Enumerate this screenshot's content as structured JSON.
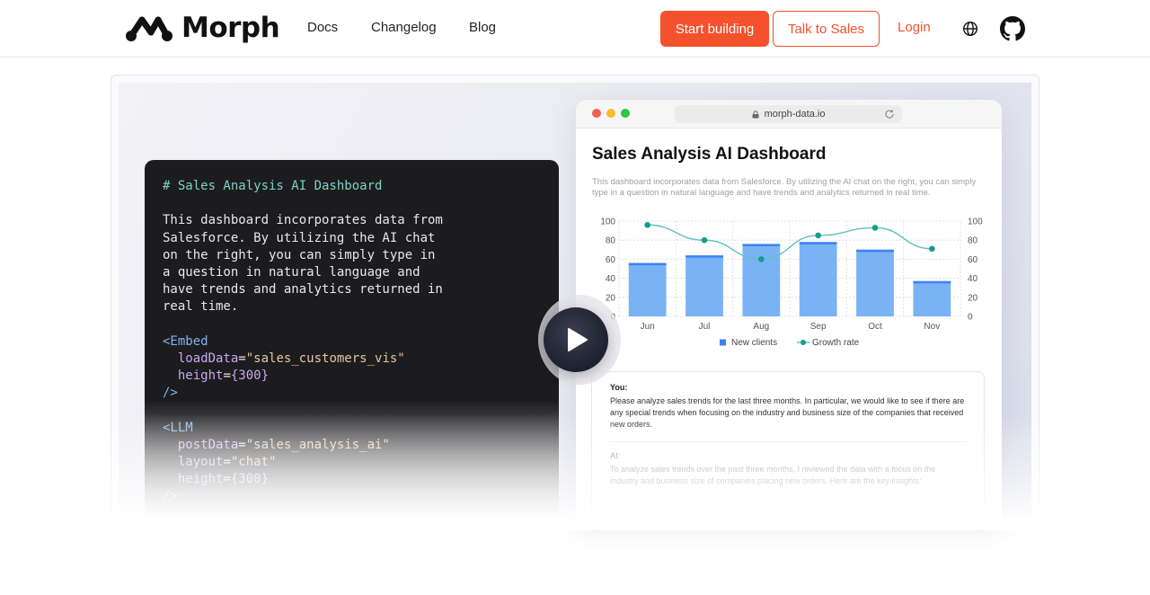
{
  "nav": {
    "logo_text": "Morph",
    "links": [
      "Docs",
      "Changelog",
      "Blog"
    ],
    "start_building": "Start building",
    "talk_to_sales": "Talk to Sales",
    "login": "Login"
  },
  "code_panel": {
    "lines": [
      {
        "text": "# Sales Analysis AI Dashboard",
        "kind": "comment"
      },
      {
        "text": "",
        "kind": "plain"
      },
      {
        "text": "This dashboard incorporates data from",
        "kind": "plain"
      },
      {
        "text": "Salesforce. By utilizing the AI chat",
        "kind": "plain"
      },
      {
        "text": "on the right, you can simply type in",
        "kind": "plain"
      },
      {
        "text": "a question in natural language and",
        "kind": "plain"
      },
      {
        "text": "have trends and analytics returned in",
        "kind": "plain"
      },
      {
        "text": "real time.",
        "kind": "plain"
      },
      {
        "text": "",
        "kind": "plain"
      },
      {
        "text": "<Embed",
        "kind": "tag"
      },
      {
        "text": "  loadData=\"sales_customers_vis\"",
        "kind": "attr"
      },
      {
        "text": "  height={300}",
        "kind": "attr"
      },
      {
        "text": "/>",
        "kind": "tag"
      },
      {
        "text": "",
        "kind": "plain"
      },
      {
        "text": "<LLM",
        "kind": "tag"
      },
      {
        "text": "  postData=\"sales_analysis_ai\"",
        "kind": "attr"
      },
      {
        "text": "  layout=\"chat\"",
        "kind": "attr"
      },
      {
        "text": "  height={300}",
        "kind": "attr"
      },
      {
        "text": "/>",
        "kind": "tag"
      }
    ]
  },
  "browser": {
    "url": "morph-data.io",
    "dashboard_title": "Sales Analysis AI Dashboard",
    "dashboard_desc": "This dashboard incorporates data from Salesforce. By utilizing the AI chat on the right, you can simply type in a question in natural language and have trends and analytics returned in real time."
  },
  "chart_data": {
    "type": "bar",
    "categories": [
      "Jun",
      "Jul",
      "Aug",
      "Sep",
      "Oct",
      "Nov"
    ],
    "series": [
      {
        "name": "New clients",
        "kind": "bar",
        "values": [
          56,
          64,
          76,
          78,
          70,
          37
        ]
      },
      {
        "name": "Growth rate",
        "kind": "line",
        "values": [
          96,
          80,
          60,
          85,
          93,
          71
        ]
      }
    ],
    "ylim": [
      0,
      100
    ],
    "yticks": [
      0,
      20,
      40,
      60,
      80,
      100
    ],
    "y2ticks": [
      0,
      20,
      40,
      60,
      80,
      100
    ],
    "legend_position": "bottom",
    "grid": true,
    "colors": {
      "bar": "#7ab3f5",
      "bar_top": "#3b82f6",
      "line": "#5fc0bd",
      "point": "#149c8e"
    }
  },
  "chat": {
    "user_role": "You:",
    "user_text": "Please analyze sales trends for the last three months. In particular, we would like to see if there are any special trends when focusing on the industry and business size of the companies that received new orders.",
    "ai_role": "AI:",
    "ai_text": "To analyze sales trends over the past three months, I reviewed the data with a focus on the industry and business size of companies placing new orders. Here are the key insights:"
  },
  "colors": {
    "accent": "#f4512c"
  }
}
